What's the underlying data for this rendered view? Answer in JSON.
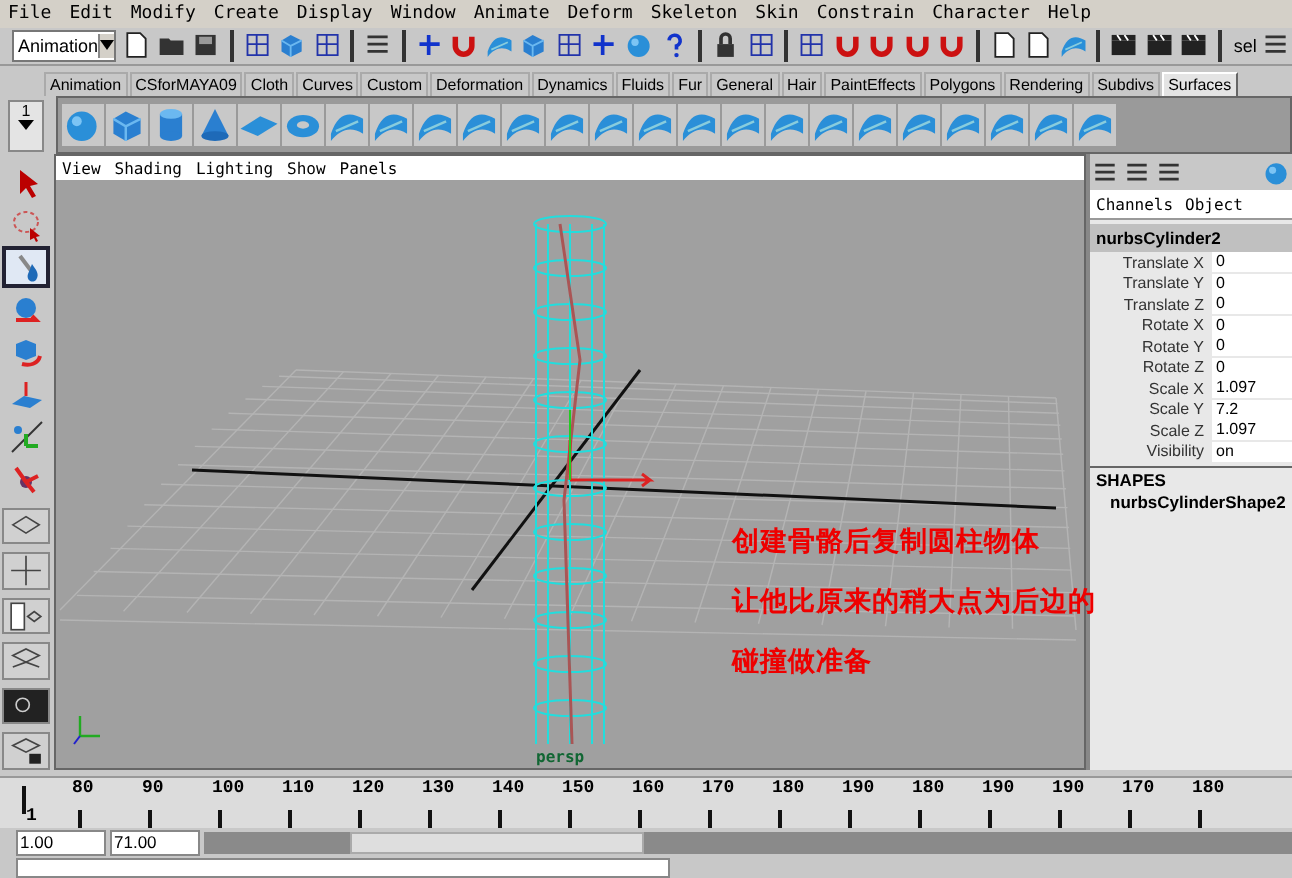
{
  "menu_bar": [
    "File",
    "Edit",
    "Modify",
    "Create",
    "Display",
    "Window",
    "Animate",
    "Deform",
    "Skeleton",
    "Skin",
    "Constrain",
    "Character",
    "Help"
  ],
  "status_line": {
    "mode": "Animation",
    "select_label": "sel"
  },
  "shelf": {
    "tabs": [
      {
        "label": "Animation",
        "selected": false
      },
      {
        "label": "CSforMAYA09",
        "selected": false
      },
      {
        "label": "Cloth",
        "selected": false
      },
      {
        "label": "Curves",
        "selected": false
      },
      {
        "label": "Custom",
        "selected": false
      },
      {
        "label": "Deformation",
        "selected": false
      },
      {
        "label": "Dynamics",
        "selected": false
      },
      {
        "label": "Fluids",
        "selected": false
      },
      {
        "label": "Fur",
        "selected": false
      },
      {
        "label": "General",
        "selected": false
      },
      {
        "label": "Hair",
        "selected": false
      },
      {
        "label": "PaintEffects",
        "selected": false
      },
      {
        "label": "Polygons",
        "selected": false
      },
      {
        "label": "Rendering",
        "selected": false
      },
      {
        "label": "Subdivs",
        "selected": false
      },
      {
        "label": "Surfaces",
        "selected": true
      }
    ],
    "shelf_number": "1"
  },
  "toolbox": [
    {
      "kind": "select",
      "selected": false
    },
    {
      "kind": "lasso",
      "selected": false
    },
    {
      "kind": "paint",
      "selected": true
    },
    {
      "kind": "move",
      "selected": false
    },
    {
      "kind": "rotate",
      "selected": false
    },
    {
      "kind": "softmod",
      "selected": false
    },
    {
      "kind": "manipulator",
      "selected": false
    },
    {
      "kind": "last",
      "selected": false
    }
  ],
  "viewport": {
    "panel_menu": [
      "View",
      "Shading",
      "Lighting",
      "Show",
      "Panels"
    ],
    "annotation": [
      "创建骨骼后复制圆柱物体",
      "让他比原来的稍大点为后边的",
      "碰撞做准备"
    ],
    "camera": "persp"
  },
  "channel_box": {
    "menu": [
      "Channels",
      "Object"
    ],
    "node": "nurbsCylinder2",
    "attributes": [
      {
        "name": "Translate X",
        "value": "0"
      },
      {
        "name": "Translate Y",
        "value": "0"
      },
      {
        "name": "Translate Z",
        "value": "0"
      },
      {
        "name": "Rotate X",
        "value": "0"
      },
      {
        "name": "Rotate Y",
        "value": "0"
      },
      {
        "name": "Rotate Z",
        "value": "0"
      },
      {
        "name": "Scale X",
        "value": "1.097"
      },
      {
        "name": "Scale Y",
        "value": "7.2"
      },
      {
        "name": "Scale Z",
        "value": "1.097"
      },
      {
        "name": "Visibility",
        "value": "on"
      }
    ],
    "shapes_heading": "SHAPES",
    "shape": "nurbsCylinderShape2"
  },
  "time_slider": {
    "start": "1",
    "ticks": [
      "80",
      "90",
      "100",
      "110",
      "120",
      "130",
      "140",
      "150",
      "160",
      "170",
      "180",
      "190",
      "180",
      "190",
      "190",
      "170",
      "180"
    ]
  },
  "range_slider": {
    "start": "1.00",
    "end": "71.00"
  }
}
